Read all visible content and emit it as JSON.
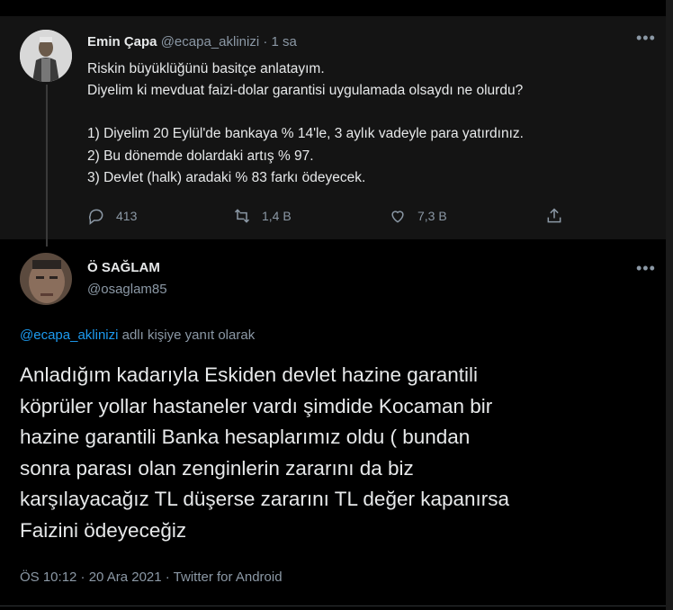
{
  "parent_tweet": {
    "author_name": "Emin Çapa",
    "author_handle": "@ecapa_aklinizi",
    "separator": "·",
    "time": "1 sa",
    "text_lines": [
      "Riskin büyüklüğünü basitçe anlatayım.",
      "Diyelim ki mevduat faizi-dolar garantisi uygulamada olsaydı ne olurdu?",
      "",
      "1) Diyelim 20 Eylül'de bankaya % 14'le, 3 aylık vadeyle para yatırdınız.",
      "2) Bu dönemde dolardaki artış % 97.",
      "3) Devlet (halk) aradaki % 83 farkı ödeyecek."
    ],
    "reply_count": "413",
    "retweet_count": "1,4 B",
    "like_count": "7,3 B",
    "icons": [
      "reply-icon",
      "retweet-icon",
      "like-icon",
      "share-icon",
      "more-icon"
    ]
  },
  "reply_tweet": {
    "author_name": "Ö SAĞLAM",
    "author_handle": "@osaglam85",
    "replying_to_handle": "@ecapa_aklinizi",
    "replying_to_suffix": " adlı kişiye yanıt olarak",
    "text_lines": [
      "Anladığım kadarıyla Eskiden devlet hazine garantili",
      "köprüler yollar hastaneler vardı şimdide Kocaman bir",
      "hazine garantili Banka hesaplarımız oldu ( bundan",
      "sonra parası olan zenginlerin zararını da biz",
      "karşılayacağız TL düşerse zararını TL değer kapanırsa",
      "Faizini ödeyeceğiz"
    ],
    "timestamp": "ÖS 10:12 · 20 Ara 2021 · Twitter for Android"
  },
  "colors": {
    "background": "#000000",
    "parent_background": "#141414",
    "link": "#1d9bf0",
    "muted": "#8b98a5"
  }
}
